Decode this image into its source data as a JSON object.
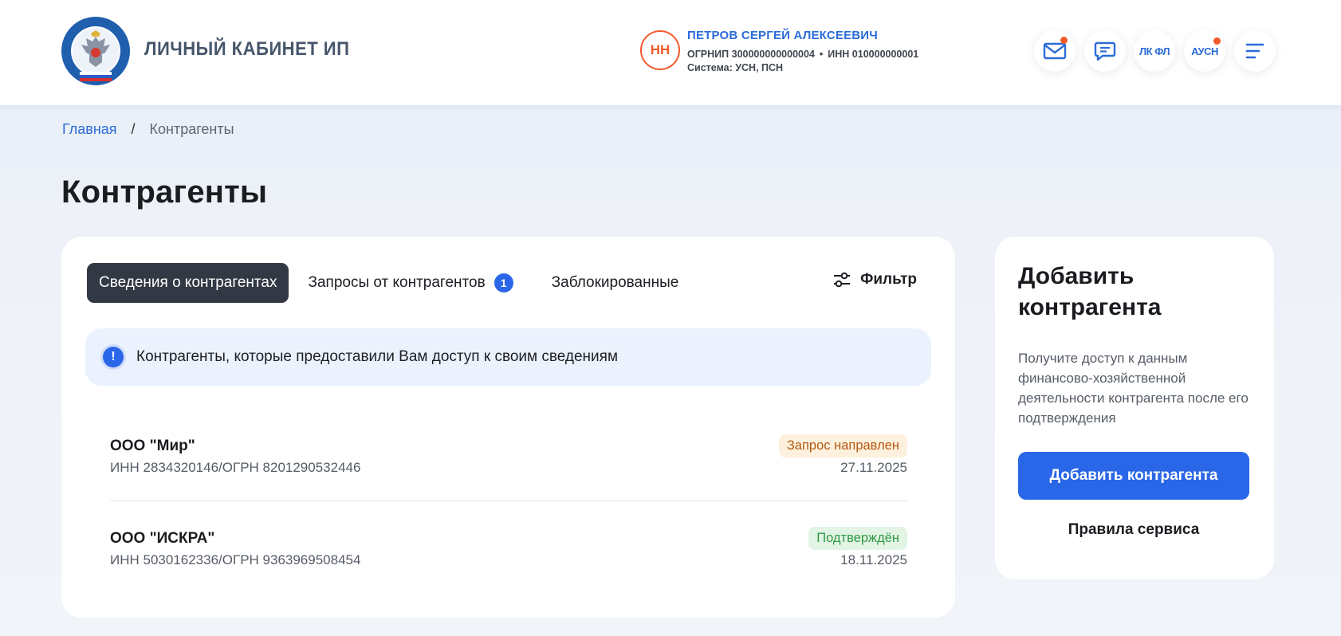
{
  "header": {
    "app_title": "ЛИЧНЫЙ КАБИНЕТ ИП",
    "logo_icon": "fns-emblem-icon",
    "user": {
      "initials": "НН",
      "name": "ПЕТРОВ СЕРГЕЙ АЛЕКСЕЕВИЧ",
      "ogrnip": "ОГРНИП 300000000000004",
      "separator": "•",
      "inn": "ИНН 010000000001",
      "system": "Система: УСН, ПСН"
    },
    "buttons": {
      "mail_icon": "mail-icon",
      "chat_icon": "chat-icon",
      "lk_fl": "ЛК ФЛ",
      "ausn": "АУСН",
      "menu_icon": "menu-icon"
    }
  },
  "breadcrumb": {
    "home": "Главная",
    "separator": "/",
    "current": "Контрагенты"
  },
  "page_title": "Контрагенты",
  "main": {
    "tabs": [
      {
        "label": "Сведения о контрагентах",
        "active": true
      },
      {
        "label": "Запросы от контрагентов",
        "badge": "1"
      },
      {
        "label": "Заблокированные"
      }
    ],
    "filter_label": "Фильтр",
    "info_icon": "!",
    "info_text": "Контрагенты, которые предоставили Вам доступ к своим сведениям",
    "rows": [
      {
        "name": "ООО \"Мир\"",
        "ids": "ИНН 2834320146/ОГРН 8201290532446",
        "status": "Запрос направлен",
        "date": "27.11.2025"
      },
      {
        "name": "ООО \"ИСКРА\"",
        "ids": "ИНН 5030162336/ОГРН 9363969508454",
        "status": "Подтверждён",
        "date": "18.11.2025"
      }
    ]
  },
  "side": {
    "title": "Добавить контрагента",
    "description": "Получите доступ к данным финансово-хозяйственной деятельности контрагента после его подтверждения",
    "button": "Добавить контрагента",
    "rules_link": "Правила сервиса"
  },
  "colors": {
    "accent": "#2a67e8",
    "link": "#2b6bd9",
    "notification": "#f2592a",
    "tab_active_bg": "#333944",
    "status_sent_bg": "#fdf1de",
    "status_sent_text": "#b45a12",
    "status_ok_bg": "#e2f4e4",
    "status_ok_text": "#2f9b46"
  }
}
